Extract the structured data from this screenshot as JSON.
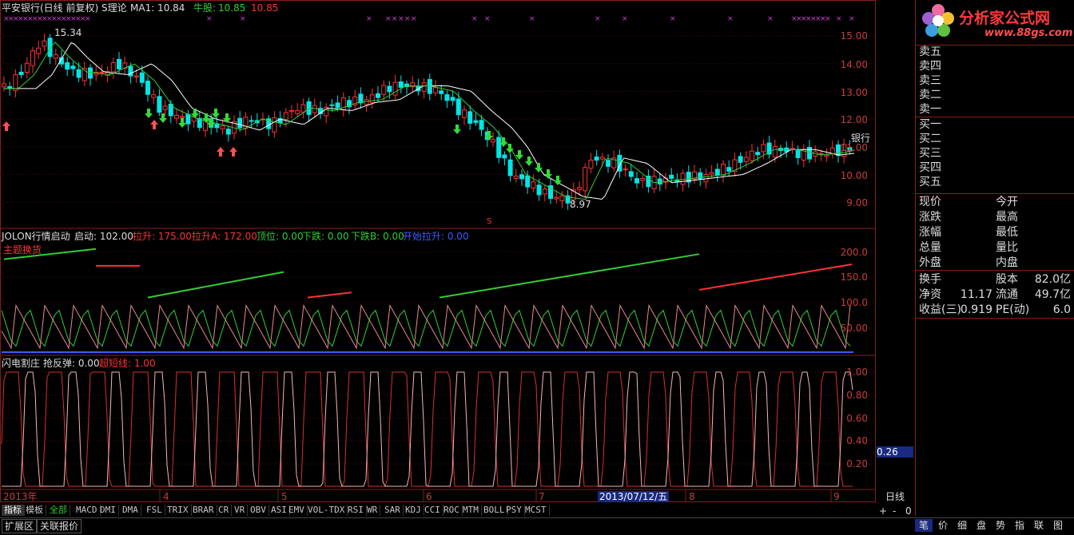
{
  "stock_header": {
    "title": "平安银行(日线 前复权) S理论",
    "ma_text": "MA1: 10.84",
    "bull_label": "牛股:",
    "bull_v1": "10.85",
    "bull_v2": "10.85"
  },
  "main_price_labels": {
    "high": "15.34",
    "low": "8.97",
    "name": "银行",
    "buy": "买",
    "sell_marker": "S"
  },
  "price_axis": [
    "15.00",
    "14.00",
    "13.00",
    "12.00",
    "11.00",
    "10.00",
    "9.00"
  ],
  "ind1_header": {
    "name": "JOLON行情启动",
    "start": "启动: 102.00",
    "lift": "拉升: 175.00",
    "lift_a": "拉升A: 172.00",
    "top": "顶位: 0.00",
    "down": "下跌: 0.00",
    "down_b": "下跌B: 0.00",
    "begin": "开始拉升: 0.00",
    "theme": "主题换货"
  },
  "ind1_axis": [
    "200.0",
    "150.0",
    "100.0",
    "50.00"
  ],
  "ind2_header": {
    "name": "闪电割庄",
    "rebound": "抢反弹: 0.00",
    "short": "超短线: 1.00"
  },
  "ind2_axis": [
    "1.00",
    "0.80",
    "0.60",
    "0.40",
    "0.20"
  ],
  "ind2_current": "0.26",
  "time_axis": {
    "year": "2013年",
    "months": [
      "4",
      "5",
      "6",
      "7",
      "8",
      "9"
    ],
    "cursor_date": "2013/07/12/五"
  },
  "period_label": "日线",
  "zoom_controls": [
    "+",
    "-",
    "0"
  ],
  "indicator_tabs": [
    "指标",
    "模板",
    "全部",
    "MACD",
    "DMI",
    "DMA",
    "FSL",
    "TRIX",
    "BRAR",
    "CR",
    "VR",
    "OBV",
    "ASI",
    "EMV",
    "VOL-TDX",
    "RSI",
    "WR",
    "SAR",
    "KDJ",
    "CCI",
    "ROC",
    "MTM",
    "BOLL",
    "PSY",
    "MCST"
  ],
  "bottom_tabs": [
    "扩展区",
    "关联报价"
  ],
  "right_buttons": [
    "笔",
    "价",
    "细",
    "盘",
    "势",
    "指",
    "联",
    "图"
  ],
  "logo": {
    "brand": "分析家公式网",
    "url": "www.88gs.com"
  },
  "quote_panel": {
    "sell": [
      "卖五",
      "卖四",
      "卖三",
      "卖二",
      "卖一"
    ],
    "buy": [
      "买一",
      "买二",
      "买三",
      "买四",
      "买五"
    ],
    "stats": [
      [
        "现价",
        "今开"
      ],
      [
        "涨跌",
        "最高"
      ],
      [
        "涨幅",
        "最低"
      ],
      [
        "总量",
        "量比"
      ],
      [
        "外盘",
        "内盘"
      ]
    ],
    "fund": [
      {
        "l1": "换手",
        "v1": "",
        "l2": "股本",
        "v2": "82.0亿"
      },
      {
        "l1": "净资",
        "v1": "11.17",
        "l2": "流通",
        "v2": "49.7亿"
      },
      {
        "l1": "收益(三)",
        "v1": "0.919",
        "l2": "PE(动)",
        "v2": "6.0"
      }
    ]
  },
  "colors": {
    "up": "#ff3232",
    "down": "#00e6e6",
    "ma_white": "#ffffff",
    "ma_green": "#33cc33",
    "grid_red": "#8a1c1c"
  }
}
